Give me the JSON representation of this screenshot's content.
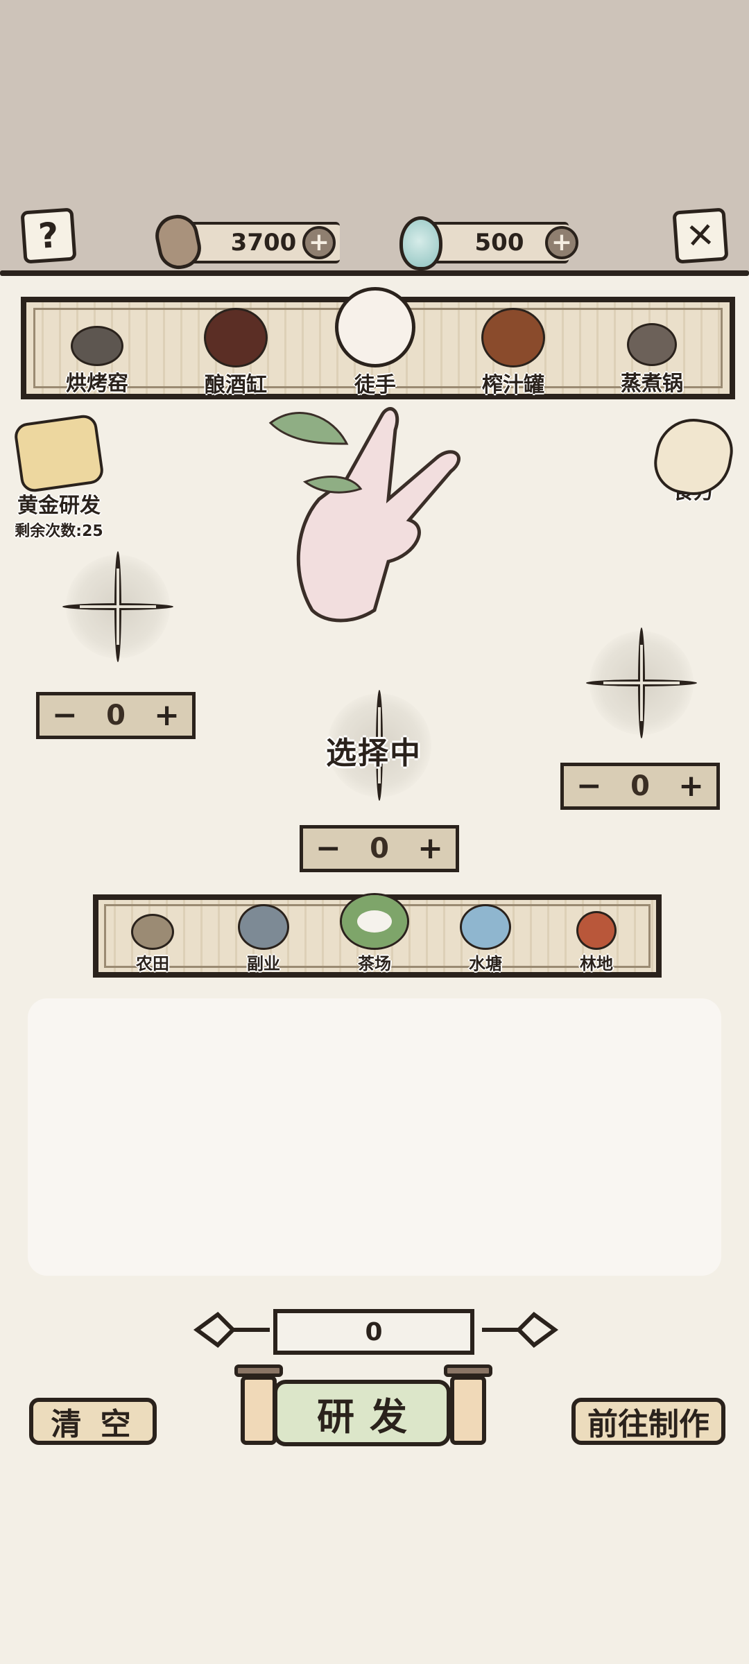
{
  "header": {
    "help_icon": "question-icon",
    "close_icon": "close-icon",
    "coins": "3700",
    "gems": "500"
  },
  "stations": [
    {
      "label": "烘烤窑",
      "icon": "kiln-pig-icon",
      "color": "#5d5650"
    },
    {
      "label": "酿酒缸",
      "icon": "wine-jar-icon",
      "color": "#5b2e25"
    },
    {
      "label": "徒手",
      "icon": "hand-icon",
      "color": "#f0d6cd"
    },
    {
      "label": "榨汁罐",
      "icon": "juice-barrel-icon",
      "color": "#8a4b2c"
    },
    {
      "label": "蒸煮锅",
      "icon": "steam-pot-icon",
      "color": "#6c6159"
    }
  ],
  "side": {
    "gold_research_label": "黄金研发",
    "remaining_label": "剩余次数:25",
    "recipe_label": "食方"
  },
  "slots": {
    "left_value": "0",
    "center_value": "0",
    "right_value": "0",
    "selecting_label": "选择中",
    "minus": "−",
    "plus": "+"
  },
  "sources": [
    {
      "label": "农田",
      "icon": "farm-icon",
      "color": "#9b8b74"
    },
    {
      "label": "副业",
      "icon": "sideline-icon",
      "color": "#7d8a95"
    },
    {
      "label": "茶场",
      "icon": "tea-field-icon",
      "color": "#7ea56a"
    },
    {
      "label": "水塘",
      "icon": "pond-icon",
      "color": "#8fb6cf"
    },
    {
      "label": "林地",
      "icon": "forest-icon",
      "color": "#b9573a"
    }
  ],
  "bottom": {
    "amount": "0",
    "clear_label": "清 空",
    "research_label": "研发",
    "goto_label": "前往制作"
  }
}
